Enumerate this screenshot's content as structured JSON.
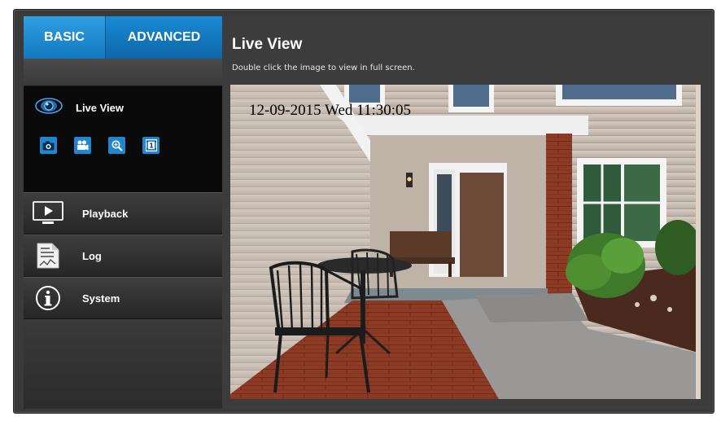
{
  "tabs": {
    "basic": "BASIC",
    "advanced": "ADVANCED"
  },
  "sidebar": {
    "live_view": "Live View",
    "tools": [
      "camera-icon",
      "video-camera-icon",
      "zoom-icon",
      "film-icon"
    ],
    "items": [
      {
        "label": "Playback",
        "icon": "playback-icon"
      },
      {
        "label": "Log",
        "icon": "log-icon"
      },
      {
        "label": "System",
        "icon": "info-icon"
      }
    ]
  },
  "main": {
    "title": "Live View",
    "subtitle": "Double click the image to view in full screen.",
    "timestamp": "12-09-2015 Wed 11:30:05"
  },
  "colors": {
    "accent": "#1f86cf",
    "panel": "#3c3c3c",
    "sidebar_active": "#0a0a0a"
  }
}
